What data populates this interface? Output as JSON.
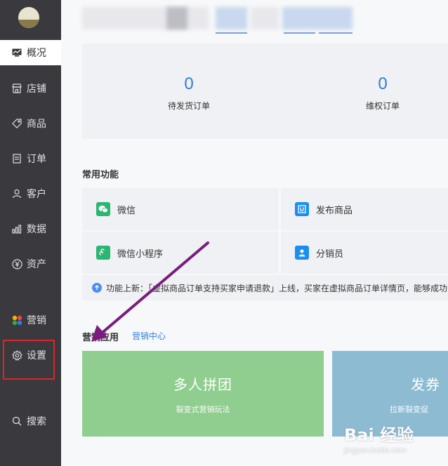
{
  "sidebar": {
    "items": [
      {
        "label": "概况",
        "icon": "overview-icon",
        "active": true
      },
      {
        "label": "店铺",
        "icon": "store-icon"
      },
      {
        "label": "商品",
        "icon": "tag-icon"
      },
      {
        "label": "订单",
        "icon": "document-icon"
      },
      {
        "label": "客户",
        "icon": "user-icon"
      },
      {
        "label": "数据",
        "icon": "bar-chart-icon"
      },
      {
        "label": "资产",
        "icon": "yen-icon"
      },
      {
        "label": "营销",
        "icon": "colorful-petals-icon"
      },
      {
        "label": "设置",
        "icon": "gear-icon"
      },
      {
        "label": "搜索",
        "icon": "search-icon"
      }
    ]
  },
  "stats": [
    {
      "value": "0",
      "label": "待发货订单"
    },
    {
      "value": "0",
      "label": "维权订单"
    }
  ],
  "common": {
    "title": "常用功能",
    "items": [
      {
        "label": "微信",
        "icon": "wechat-icon"
      },
      {
        "label": "发布商品",
        "icon": "publish-goods-icon"
      },
      {
        "label": "微信小程序",
        "icon": "mini-program-icon"
      },
      {
        "label": "分销员",
        "icon": "distributor-icon"
      }
    ]
  },
  "notice": "功能上新：「虚拟商品订单支持买家申请退款」上线，买家在虚拟商品订单详情页，能够成功",
  "marketing": {
    "title": "营销应用",
    "link": "营销中心",
    "cards": [
      {
        "title": "多人拼团",
        "subtitle": "裂变式营销玩法",
        "color": "#8fce8f"
      },
      {
        "title": "发券",
        "subtitle": "拉新裂变促",
        "color": "#8dbcd2"
      }
    ]
  },
  "watermark": {
    "text": "Bai 经验",
    "sub": "jingyan.baidu.com"
  },
  "colors": {
    "sidebar": "#3a3a3e",
    "accent": "#2f7ed8",
    "highlight": "#d9262b",
    "arrow": "#7a1c7f"
  }
}
